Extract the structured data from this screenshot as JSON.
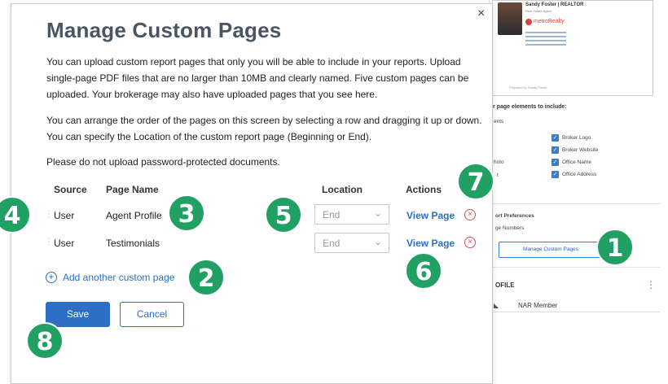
{
  "background": {
    "preview": {
      "agent_name": "Sandy Foster | REALTOR",
      "agent_sub": "Real Estate Agent",
      "logo_text": "metroRealty",
      "footer_text": "Prepared by Sandy Foster"
    },
    "elements_heading": "r page elements to include:",
    "labels": [
      "ents",
      "hoto",
      "t"
    ],
    "checkboxes": [
      "Broker Logo",
      "Broker Website",
      "Office Name",
      "Office Address"
    ],
    "report_prefs": "ort Preferences",
    "page_numbers": "ge Numbers",
    "manage_button": "Manage Custom Pages",
    "profile_heading": "OFILE",
    "nar_member": "NAR Member"
  },
  "modal": {
    "title": "Manage Custom Pages",
    "paragraphs": [
      "You can upload custom report pages that only you will be able to include in your reports. Upload single-page PDF files that are no larger than 10MB and clearly named. Five custom pages can be uploaded. Your brokerage may also have uploaded pages that you see here.",
      "You can arrange the order of the pages on this screen by selecting a row and dragging it up or down. You can specify the Location of the custom report page (Beginning or End).",
      "Please do not upload password-protected documents."
    ],
    "columns": {
      "source": "Source",
      "page_name": "Page Name",
      "location": "Location",
      "actions": "Actions"
    },
    "rows": [
      {
        "source": "User",
        "page_name": "Agent Profile",
        "location": "End",
        "action": "View Page"
      },
      {
        "source": "User",
        "page_name": "Testimonials",
        "location": "End",
        "action": "View Page"
      }
    ],
    "add_link": "Add another custom page",
    "save": "Save",
    "cancel": "Cancel",
    "close_glyph": "×"
  },
  "badges": [
    "1",
    "2",
    "3",
    "4",
    "5",
    "6",
    "7",
    "8"
  ],
  "colors": {
    "primary": "#2d6fc4",
    "badge": "#21a064",
    "remove": "#e05050",
    "title": "#4a5564"
  }
}
